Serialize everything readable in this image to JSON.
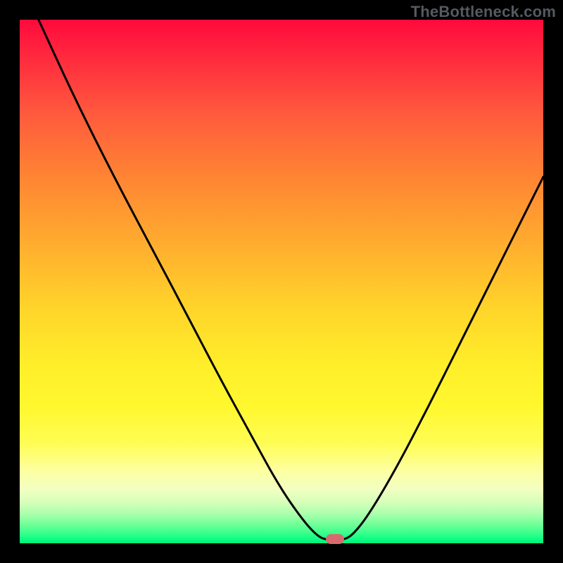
{
  "watermark": "TheBottleneck.com",
  "marker": {
    "x_frac": 0.602,
    "y_frac": 0.992
  },
  "chart_data": {
    "type": "line",
    "title": "",
    "xlabel": "",
    "ylabel": "",
    "xlim": [
      0,
      1
    ],
    "ylim": [
      0,
      1
    ],
    "series": [
      {
        "name": "curve",
        "points": [
          {
            "x": 0.036,
            "y": 0.0
          },
          {
            "x": 0.105,
            "y": 0.15
          },
          {
            "x": 0.18,
            "y": 0.3
          },
          {
            "x": 0.262,
            "y": 0.455
          },
          {
            "x": 0.315,
            "y": 0.555
          },
          {
            "x": 0.38,
            "y": 0.68
          },
          {
            "x": 0.44,
            "y": 0.79
          },
          {
            "x": 0.495,
            "y": 0.89
          },
          {
            "x": 0.54,
            "y": 0.955
          },
          {
            "x": 0.57,
            "y": 0.988
          },
          {
            "x": 0.59,
            "y": 0.994
          },
          {
            "x": 0.62,
            "y": 0.994
          },
          {
            "x": 0.64,
            "y": 0.98
          },
          {
            "x": 0.67,
            "y": 0.94
          },
          {
            "x": 0.72,
            "y": 0.855
          },
          {
            "x": 0.78,
            "y": 0.74
          },
          {
            "x": 0.84,
            "y": 0.62
          },
          {
            "x": 0.905,
            "y": 0.49
          },
          {
            "x": 0.96,
            "y": 0.38
          },
          {
            "x": 1.0,
            "y": 0.3
          }
        ]
      }
    ],
    "marker": {
      "x": 0.602,
      "y": 0.992
    }
  }
}
